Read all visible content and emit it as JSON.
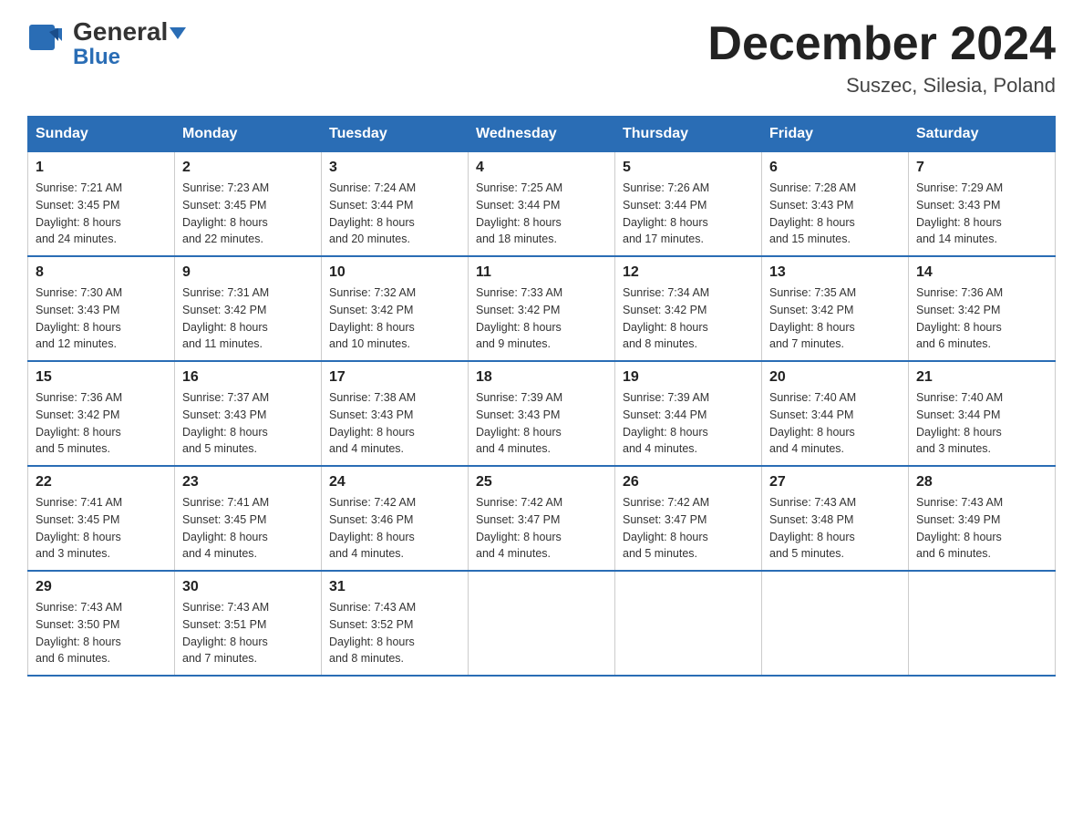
{
  "header": {
    "logo_general": "General",
    "logo_blue": "Blue",
    "month_title": "December 2024",
    "location": "Suszec, Silesia, Poland"
  },
  "days_of_week": [
    "Sunday",
    "Monday",
    "Tuesday",
    "Wednesday",
    "Thursday",
    "Friday",
    "Saturday"
  ],
  "weeks": [
    [
      {
        "day": "1",
        "info": "Sunrise: 7:21 AM\nSunset: 3:45 PM\nDaylight: 8 hours\nand 24 minutes."
      },
      {
        "day": "2",
        "info": "Sunrise: 7:23 AM\nSunset: 3:45 PM\nDaylight: 8 hours\nand 22 minutes."
      },
      {
        "day": "3",
        "info": "Sunrise: 7:24 AM\nSunset: 3:44 PM\nDaylight: 8 hours\nand 20 minutes."
      },
      {
        "day": "4",
        "info": "Sunrise: 7:25 AM\nSunset: 3:44 PM\nDaylight: 8 hours\nand 18 minutes."
      },
      {
        "day": "5",
        "info": "Sunrise: 7:26 AM\nSunset: 3:44 PM\nDaylight: 8 hours\nand 17 minutes."
      },
      {
        "day": "6",
        "info": "Sunrise: 7:28 AM\nSunset: 3:43 PM\nDaylight: 8 hours\nand 15 minutes."
      },
      {
        "day": "7",
        "info": "Sunrise: 7:29 AM\nSunset: 3:43 PM\nDaylight: 8 hours\nand 14 minutes."
      }
    ],
    [
      {
        "day": "8",
        "info": "Sunrise: 7:30 AM\nSunset: 3:43 PM\nDaylight: 8 hours\nand 12 minutes."
      },
      {
        "day": "9",
        "info": "Sunrise: 7:31 AM\nSunset: 3:42 PM\nDaylight: 8 hours\nand 11 minutes."
      },
      {
        "day": "10",
        "info": "Sunrise: 7:32 AM\nSunset: 3:42 PM\nDaylight: 8 hours\nand 10 minutes."
      },
      {
        "day": "11",
        "info": "Sunrise: 7:33 AM\nSunset: 3:42 PM\nDaylight: 8 hours\nand 9 minutes."
      },
      {
        "day": "12",
        "info": "Sunrise: 7:34 AM\nSunset: 3:42 PM\nDaylight: 8 hours\nand 8 minutes."
      },
      {
        "day": "13",
        "info": "Sunrise: 7:35 AM\nSunset: 3:42 PM\nDaylight: 8 hours\nand 7 minutes."
      },
      {
        "day": "14",
        "info": "Sunrise: 7:36 AM\nSunset: 3:42 PM\nDaylight: 8 hours\nand 6 minutes."
      }
    ],
    [
      {
        "day": "15",
        "info": "Sunrise: 7:36 AM\nSunset: 3:42 PM\nDaylight: 8 hours\nand 5 minutes."
      },
      {
        "day": "16",
        "info": "Sunrise: 7:37 AM\nSunset: 3:43 PM\nDaylight: 8 hours\nand 5 minutes."
      },
      {
        "day": "17",
        "info": "Sunrise: 7:38 AM\nSunset: 3:43 PM\nDaylight: 8 hours\nand 4 minutes."
      },
      {
        "day": "18",
        "info": "Sunrise: 7:39 AM\nSunset: 3:43 PM\nDaylight: 8 hours\nand 4 minutes."
      },
      {
        "day": "19",
        "info": "Sunrise: 7:39 AM\nSunset: 3:44 PM\nDaylight: 8 hours\nand 4 minutes."
      },
      {
        "day": "20",
        "info": "Sunrise: 7:40 AM\nSunset: 3:44 PM\nDaylight: 8 hours\nand 4 minutes."
      },
      {
        "day": "21",
        "info": "Sunrise: 7:40 AM\nSunset: 3:44 PM\nDaylight: 8 hours\nand 3 minutes."
      }
    ],
    [
      {
        "day": "22",
        "info": "Sunrise: 7:41 AM\nSunset: 3:45 PM\nDaylight: 8 hours\nand 3 minutes."
      },
      {
        "day": "23",
        "info": "Sunrise: 7:41 AM\nSunset: 3:45 PM\nDaylight: 8 hours\nand 4 minutes."
      },
      {
        "day": "24",
        "info": "Sunrise: 7:42 AM\nSunset: 3:46 PM\nDaylight: 8 hours\nand 4 minutes."
      },
      {
        "day": "25",
        "info": "Sunrise: 7:42 AM\nSunset: 3:47 PM\nDaylight: 8 hours\nand 4 minutes."
      },
      {
        "day": "26",
        "info": "Sunrise: 7:42 AM\nSunset: 3:47 PM\nDaylight: 8 hours\nand 5 minutes."
      },
      {
        "day": "27",
        "info": "Sunrise: 7:43 AM\nSunset: 3:48 PM\nDaylight: 8 hours\nand 5 minutes."
      },
      {
        "day": "28",
        "info": "Sunrise: 7:43 AM\nSunset: 3:49 PM\nDaylight: 8 hours\nand 6 minutes."
      }
    ],
    [
      {
        "day": "29",
        "info": "Sunrise: 7:43 AM\nSunset: 3:50 PM\nDaylight: 8 hours\nand 6 minutes."
      },
      {
        "day": "30",
        "info": "Sunrise: 7:43 AM\nSunset: 3:51 PM\nDaylight: 8 hours\nand 7 minutes."
      },
      {
        "day": "31",
        "info": "Sunrise: 7:43 AM\nSunset: 3:52 PM\nDaylight: 8 hours\nand 8 minutes."
      },
      null,
      null,
      null,
      null
    ]
  ]
}
